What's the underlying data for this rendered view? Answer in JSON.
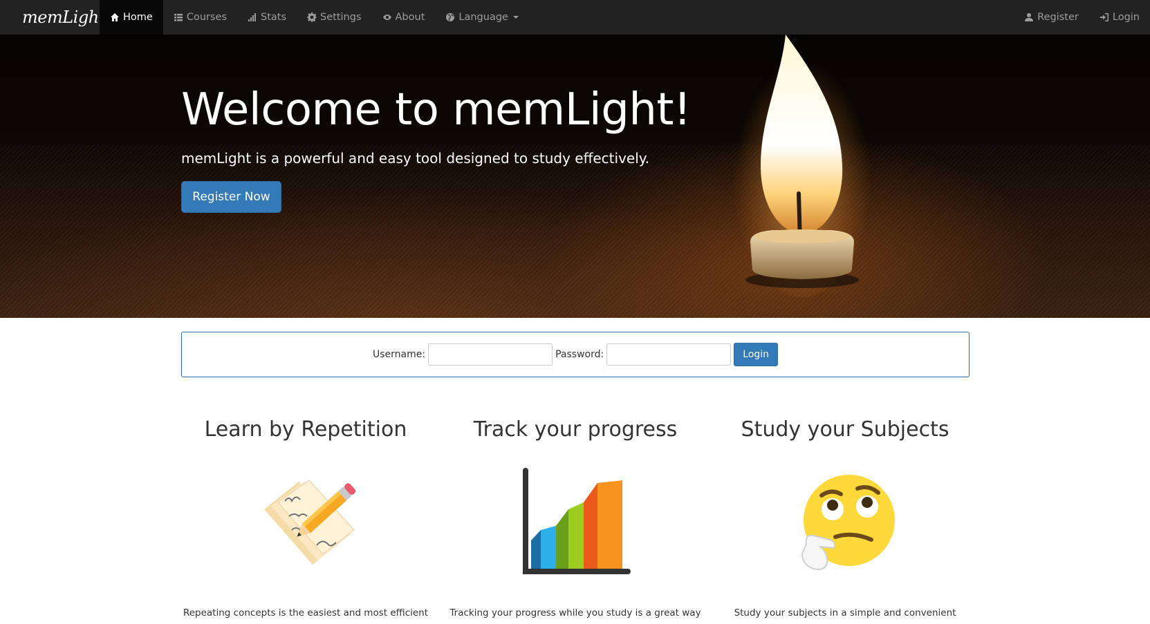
{
  "navbar": {
    "brand": "memLight",
    "items": [
      {
        "label": "Home",
        "icon": "home-icon",
        "active": true
      },
      {
        "label": "Courses",
        "icon": "list-icon"
      },
      {
        "label": "Stats",
        "icon": "stats-icon"
      },
      {
        "label": "Settings",
        "icon": "gear-icon"
      },
      {
        "label": "About",
        "icon": "eye-icon"
      },
      {
        "label": "Language",
        "icon": "globe-icon",
        "dropdown": true
      }
    ],
    "right": [
      {
        "label": "Register",
        "icon": "user-icon"
      },
      {
        "label": "Login",
        "icon": "login-icon"
      }
    ]
  },
  "hero": {
    "title": "Welcome to memLight!",
    "subtitle": "memLight is a powerful and easy tool designed to study effectively.",
    "cta_label": "Register Now"
  },
  "login": {
    "username_label": "Username:",
    "password_label": "Password:",
    "username_value": "",
    "password_value": "",
    "submit_label": "Login"
  },
  "features": [
    {
      "title": "Learn by Repetition",
      "icon": "notes-pencil-icon",
      "text": "Repeating concepts is the easiest and most efficient"
    },
    {
      "title": "Track your progress",
      "icon": "bar-chart-icon",
      "text": "Tracking your progress while you study is a great way"
    },
    {
      "title": "Study your Subjects",
      "icon": "thinking-face-icon",
      "text": "Study your subjects in a simple and convenient"
    }
  ],
  "colors": {
    "navbar_bg": "#222222",
    "navbar_active_bg": "#080808",
    "primary": "#337ab7",
    "primary_border": "#2e6da4"
  }
}
